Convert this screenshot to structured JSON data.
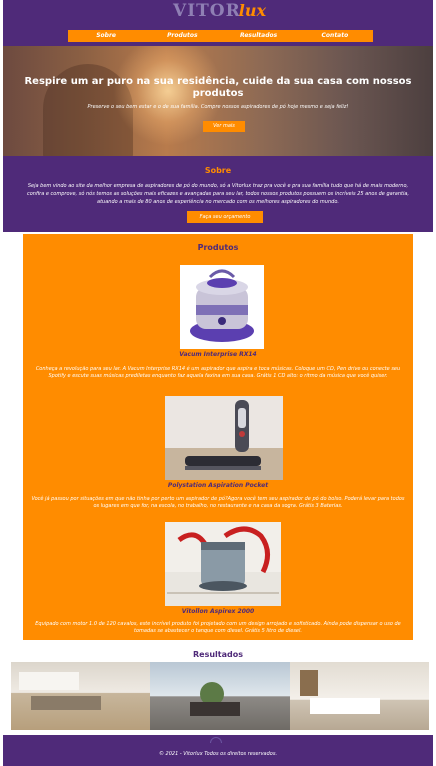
{
  "logo": {
    "part1": "VITOR",
    "part2": "lux"
  },
  "nav": {
    "items": [
      "Sobre",
      "Produtos",
      "Resultados",
      "Contato"
    ]
  },
  "hero": {
    "title": "Respire um ar puro na sua residência, cuide da sua casa com nossos produtos",
    "subtitle": "Preserve o seu bem estar e o de sua família. Compre nossos aspiradores de pó hoje mesmo e seja feliz!",
    "button": "Ver mais"
  },
  "about": {
    "title": "Sobre",
    "text": "Seja bem vindo ao site da melhor empresa de aspiradores de pó do mundo, só a Vitorlux traz pra você e pra sua família tudo que há de mais moderno, confira e comprove, só nós temos as soluções mais eficazes e avançadas para seu lar, todos nossos produtos possuem os incríveis 25 anos de garantia, atuando a mais de 80 anos de experiência no mercado com os melhores aspiradores do mundo.",
    "button": "Faça seu orçamento"
  },
  "products": {
    "title": "Produtos",
    "items": [
      {
        "name": "Vacum Interprise RX14",
        "description": "Conheça a revolução para seu lar. A Vacum Interprise RX14 é um aspirador que aspira e toca músicas. Coloque um CD, Pen drive ou conecte seu Spotify e escute suas músicas prediletas enquanto faz aquela faxina em sua casa. Grátis 1 CD alto: o ritmo da música que você quiser."
      },
      {
        "name": "Polystation Aspiration Pocket",
        "description": "Você já passou por situações em que não tinha por perto um aspirador de pó?Agora você tem seu aspirador de pó do bolso. Poderá levar para todos os lugares em que for, na escola, no trabalho, no restaurante e na casa da sogra. Grátis 3 Baterias."
      },
      {
        "name": "Vitollon Aspirex 2000",
        "description": "Equipado com motor 1.0 de 120 cavalos, este incrível produto foi projetado com um design arrojado e sofisticado. Ainda pode dispensar o uso de tomadas se abastecer o tanque com diesel. Grátis 5 litro de diesel."
      }
    ]
  },
  "results": {
    "title": "Resultados"
  },
  "footer": {
    "text": "© 2021 - Vitorlux Todos os direitos reservados."
  },
  "colors": {
    "purple": "#4f2a79",
    "orange": "#ff8c00"
  }
}
